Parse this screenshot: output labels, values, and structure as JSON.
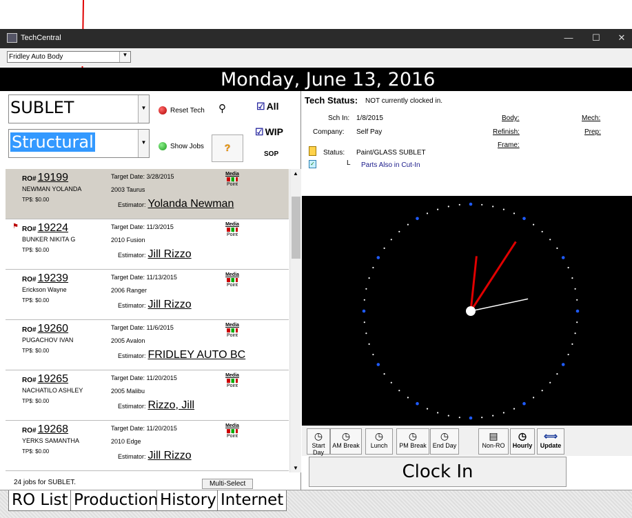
{
  "window": {
    "title": "TechCentral",
    "controls": {
      "minimize": "—",
      "maximize": "☐",
      "close": "✕"
    }
  },
  "shop_selector": {
    "value": "Fridley Auto Body"
  },
  "date": "Monday, June 13, 2016",
  "filters": {
    "category": "SUBLET",
    "subcategory": "Structural",
    "reset_tech": "Reset Tech",
    "show_jobs": "Show Jobs",
    "all": "All",
    "wip": "WIP",
    "sop": "SOP",
    "help": "?"
  },
  "ro_list": [
    {
      "ro": "19199",
      "name": "NEWMAN YOLANDA",
      "tp": "TP$: $0.00",
      "target": "Target Date: 3/28/2015",
      "vehicle": "2003   Taurus",
      "estimator": "Yolanda Newman",
      "flag": false,
      "selected": true
    },
    {
      "ro": "19224",
      "name": "BUNKER NIKITA G",
      "tp": "TP$: $0.00",
      "target": "Target Date: 11/3/2015",
      "vehicle": "2010   Fusion",
      "estimator": "Jill Rizzo",
      "flag": true,
      "selected": false
    },
    {
      "ro": "19239",
      "name": "Erickson Wayne",
      "tp": "TP$: $0.00",
      "target": "Target Date: 11/13/2015",
      "vehicle": "2006   Ranger",
      "estimator": "Jill Rizzo",
      "flag": false,
      "selected": false
    },
    {
      "ro": "19260",
      "name": "PUGACHOV IVAN",
      "tp": "TP$: $0.00",
      "target": "Target Date: 11/6/2015",
      "vehicle": "2005   Avalon",
      "estimator": "FRIDLEY AUTO BC",
      "flag": false,
      "selected": false
    },
    {
      "ro": "19265",
      "name": "NACHATILO ASHLEY",
      "tp": "TP$: $0.00",
      "target": "Target Date: 11/20/2015",
      "vehicle": "2005   Malibu",
      "estimator": "Rizzo, Jill",
      "flag": false,
      "selected": false
    },
    {
      "ro": "19268",
      "name": "YERKS SAMANTHA",
      "tp": "TP$: $0.00",
      "target": "Target Date: 11/20/2015",
      "vehicle": "2010   Edge",
      "estimator": "Jill Rizzo",
      "flag": false,
      "selected": false
    }
  ],
  "ro_labels": {
    "ro_prefix": "RO#",
    "estimator": "Estimator:",
    "media1": "Media",
    "media2": "Point"
  },
  "footer": {
    "count": "24 jobs for SUBLET.",
    "multi_select": "Multi-Select"
  },
  "tabs": [
    "RO List",
    "Production",
    "History",
    "Internet"
  ],
  "tech": {
    "status_label": "Tech Status:",
    "status_value": "NOT currently clocked in.",
    "sch_in_label": "Sch In:",
    "sch_in": "1/8/2015",
    "company_label": "Company:",
    "company": "Self Pay",
    "status_row_label": "Status:",
    "status": "Paint/GLASS SUBLET",
    "parts": "Parts Also in Cut-In",
    "links": [
      "Body:",
      "Refinish:",
      "Frame:",
      "Mech:",
      "Prep:"
    ]
  },
  "clock": {
    "hour_angle": 6,
    "minute_angle": 33,
    "second_angle": 78
  },
  "buttons": [
    {
      "label": "Start Day",
      "icon": "clock-icon"
    },
    {
      "label": "AM Break",
      "icon": "clock-icon"
    },
    {
      "label": "Lunch",
      "icon": "clock-icon"
    },
    {
      "label": "PM Break",
      "icon": "clock-icon"
    },
    {
      "label": "End Day",
      "icon": "clock-icon"
    },
    {
      "label": "Non-RO",
      "icon": "note-icon"
    },
    {
      "label": "Hourly",
      "icon": "clock-icon"
    },
    {
      "label": "Update",
      "icon": "arrows-icon"
    }
  ],
  "clock_in": "Clock In",
  "colors": {
    "accent_red": "#e00000",
    "selection_blue": "#3399ff",
    "dot_blue": "#1f5bff"
  }
}
